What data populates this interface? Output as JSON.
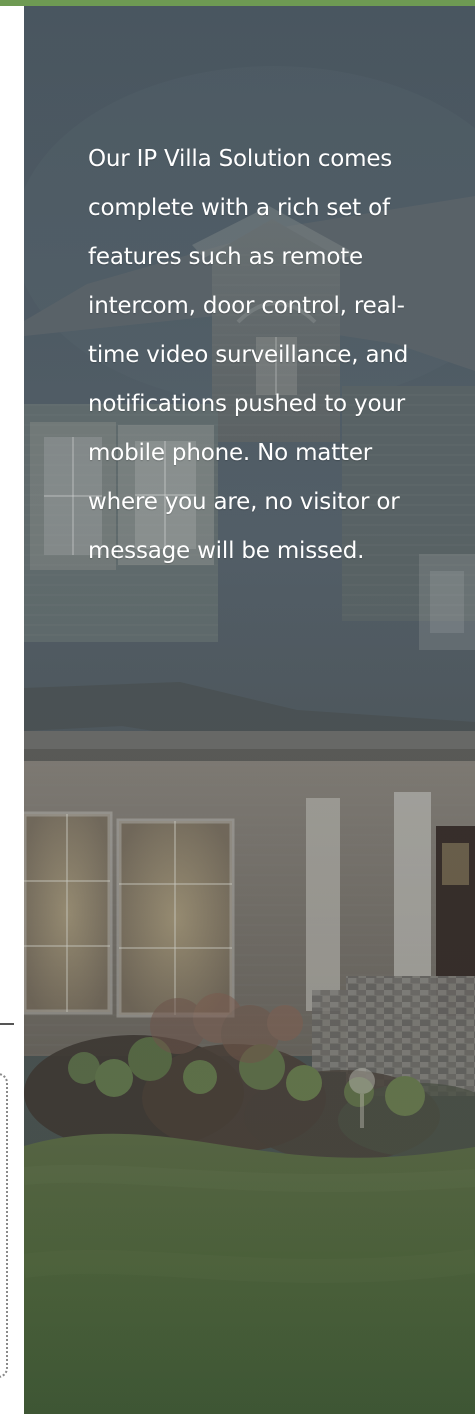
{
  "hero": {
    "description": "Our IP Villa Solution comes complete with a rich set of features such as remote intercom, door control, real-time video surveillance, and notifications pushed to your mobile phone. No matter where you are, no visitor or message will be missed."
  },
  "colors": {
    "accent_top_strip": "#6e9a53",
    "text": "#ffffff",
    "divider": "#555555",
    "dotted_border": "#8a8a8a"
  }
}
